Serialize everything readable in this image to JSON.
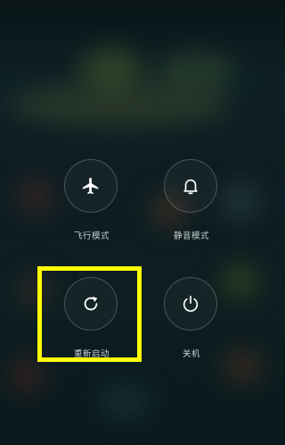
{
  "power_menu": {
    "items": [
      {
        "id": "airplane",
        "label": "飞行模式",
        "icon": "airplane-icon"
      },
      {
        "id": "silent",
        "label": "静音模式",
        "icon": "bell-icon"
      },
      {
        "id": "reboot",
        "label": "重新启动",
        "icon": "restart-icon"
      },
      {
        "id": "power",
        "label": "关机",
        "icon": "power-icon"
      }
    ]
  },
  "colors": {
    "highlight": "#ffff00",
    "icon": "#ffffff",
    "label": "#c9d2d4",
    "circle_border": "rgba(255,255,255,0.22)"
  }
}
